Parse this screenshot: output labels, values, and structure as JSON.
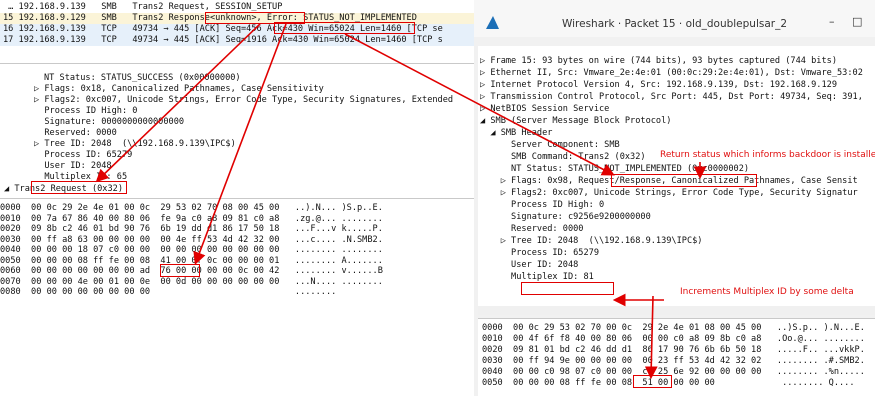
{
  "packet_list": [
    {
      "no": "",
      "text": " … 192.168.9.139   SMB   Trans2 Request, SESSION_SETUP"
    },
    {
      "no": "15",
      "text": "15 192.168.9.129   SMB   Trans2 Response<unknown>, Error: STATUS_NOT_IMPLEMENTED"
    },
    {
      "no": "16",
      "text": "16 192.168.9.139   TCP   49734 → 445 [ACK] Seq=456 Ack=430 Win=65024 Len=1460 [TCP se"
    },
    {
      "no": "17",
      "text": "17 192.168.9.139   TCP   49734 → 445 [ACK] Seq=1916 Ack=430 Win=65024 Len=1460 [TCP s"
    }
  ],
  "left_tree": [
    "NT Status: STATUS_SUCCESS (0x00000000)",
    "▷ Flags: 0x18, Canonicalized Pathnames, Case Sensitivity",
    "▷ Flags2: 0xc007, Unicode Strings, Error Code Type, Security Signatures, Extended",
    "  Process ID High: 0",
    "  Signature: 0000000000000000",
    "  Reserved: 0000",
    "▷ Tree ID: 2048  (\\\\192.168.9.139\\IPC$)",
    "  Process ID: 65279",
    "  User ID: 2048",
    "  Multiplex ID: 65"
  ],
  "left_tree_footer": "◢ Trans2 Request (0x32)",
  "left_hex": [
    "0000  00 0c 29 2e 4e 01 00 0c  29 53 02 70 08 00 45 00   ..).N... )S.p..E.",
    "0010  00 7a 67 86 40 00 80 06  fe 9a c0 a8 09 81 c0 a8   .zg.@... ........",
    "0020  09 8b c2 46 01 bd 90 76  6b 19 dd d1 86 17 50 18   ...F...v k.....P.",
    "0030  00 ff a8 63 00 00 00 00  00 4e ff 53 4d 42 32 00   ...c.... .N.SMB2.",
    "0040  00 00 00 18 07 c0 00 00  00 00 00 00 00 00 00 00   ........ ........",
    "0050  00 00 00 08 ff fe 00 08  41 00 0f 0c 00 00 00 01   ........ A.......",
    "0060  00 00 00 00 00 00 00 ad  76 00 00 00 00 0c 00 42   ........ v......B",
    "0070  00 00 00 4e 00 01 00 0e  00 0d 00 00 00 00 00 00   ...N.... ........",
    "0080  00 00 00 00 00 00 00 00                            ........"
  ],
  "window": {
    "title": "Wireshark · Packet 15 · old_doublepulsar_2",
    "minimize": "–",
    "maximize": "□"
  },
  "right_tree": [
    "▷ Frame 15: 93 bytes on wire (744 bits), 93 bytes captured (744 bits)",
    "▷ Ethernet II, Src: Vmware_2e:4e:01 (00:0c:29:2e:4e:01), Dst: Vmware_53:02",
    "▷ Internet Protocol Version 4, Src: 192.168.9.139, Dst: 192.168.9.129",
    "▷ Transmission Control Protocol, Src Port: 445, Dst Port: 49734, Seq: 391,",
    "▷ NetBIOS Session Service",
    "◢ SMB (Server Message Block Protocol)",
    "  ◢ SMB Header",
    "      Server Component: SMB",
    "      SMB Command: Trans2 (0x32)",
    "      NT Status: STATUS_NOT_IMPLEMENTED (0xc0000002)",
    "    ▷ Flags: 0x98, Request/Response, Canonicalized Pathnames, Case Sensit",
    "    ▷ Flags2: 0xc007, Unicode Strings, Error Code Type, Security Signatur",
    "      Process ID High: 0",
    "      Signature: c9256e9200000000",
    "      Reserved: 0000",
    "    ▷ Tree ID: 2048  (\\\\192.168.9.139\\IPC$)",
    "      Process ID: 65279",
    "      User ID: 2048",
    "      Multiplex ID: 81"
  ],
  "right_hex": [
    "0000  00 0c 29 53 02 70 00 0c  29 2e 4e 01 08 00 45 00   ..)S.p.. ).N...E.",
    "0010  00 4f 6f f8 40 00 80 06  00 00 c0 a8 09 8b c0 a8   .Oo.@... ........",
    "0020  09 81 01 bd c2 46 dd d1  86 17 90 76 6b 6b 50 18   .....F.. ...vkkP.",
    "0030  00 ff 94 9e 00 00 00 00  00 23 ff 53 4d 42 32 02   ........ .#.SMB2.",
    "0040  00 00 c0 98 07 c0 00 00  c9 25 6e 92 00 00 00 00   ........ .%n.....",
    "0050  00 00 00 08 ff fe 00 08  51 00 00 00 00             ........ Q...."
  ],
  "annotations": {
    "backdoor_note": "Return status which informs backdoor is installed",
    "multiplex_note": "Increments Multiplex ID by some delta"
  },
  "colors": {
    "annotation": "#e00000",
    "selected_row": "#fbf4d8"
  }
}
